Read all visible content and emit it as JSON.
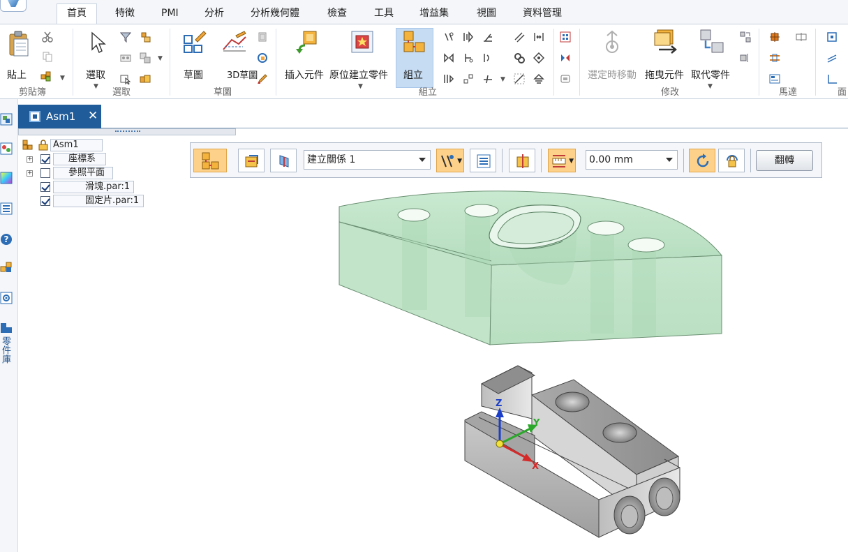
{
  "ribbon": {
    "tabs": [
      "首頁",
      "特徵",
      "PMI",
      "分析",
      "分析幾何體",
      "檢查",
      "工具",
      "增益集",
      "視圖",
      "資料管理"
    ],
    "active_tab": "首頁",
    "groups": {
      "clipboard": {
        "label": "剪貼簿",
        "paste": "貼上"
      },
      "select": {
        "label": "選取",
        "select": "選取"
      },
      "sketch": {
        "label": "草圖",
        "sketch": "草圖",
        "sketch3d": "3D草圖"
      },
      "assemble": {
        "label": "組立",
        "insert": "插入元件",
        "create_in_place": "原位建立零件",
        "assemble": "組立"
      },
      "modify": {
        "label": "修改",
        "move_when_selected": "選定時移動",
        "drag_component": "拖曳元件",
        "replace_part": "取代零件"
      },
      "motor": {
        "label": "馬達"
      },
      "face": {
        "label": "面"
      }
    }
  },
  "side_strip": {
    "label": "零件庫"
  },
  "document": {
    "tab_title": "Asm1",
    "close_glyph": "✕"
  },
  "tree": {
    "root": "Asm1",
    "items": [
      {
        "label": "座標系",
        "checked": true
      },
      {
        "label": "參照平面",
        "checked": false
      },
      {
        "label": "滑塊.par:1",
        "checked": true
      },
      {
        "label": "固定片.par:1",
        "checked": true
      }
    ]
  },
  "command_bar": {
    "relationship": "建立關係 1",
    "offset_value": "0.00 mm",
    "flip_label": "翻轉"
  },
  "viewport": {
    "triad": {
      "x": "X",
      "y": "Y",
      "z": "Z"
    }
  },
  "colors": {
    "accent_blue": "#1f5c99",
    "active_orange": "#fdd18a",
    "ghost_green": "#bfe3c4"
  }
}
